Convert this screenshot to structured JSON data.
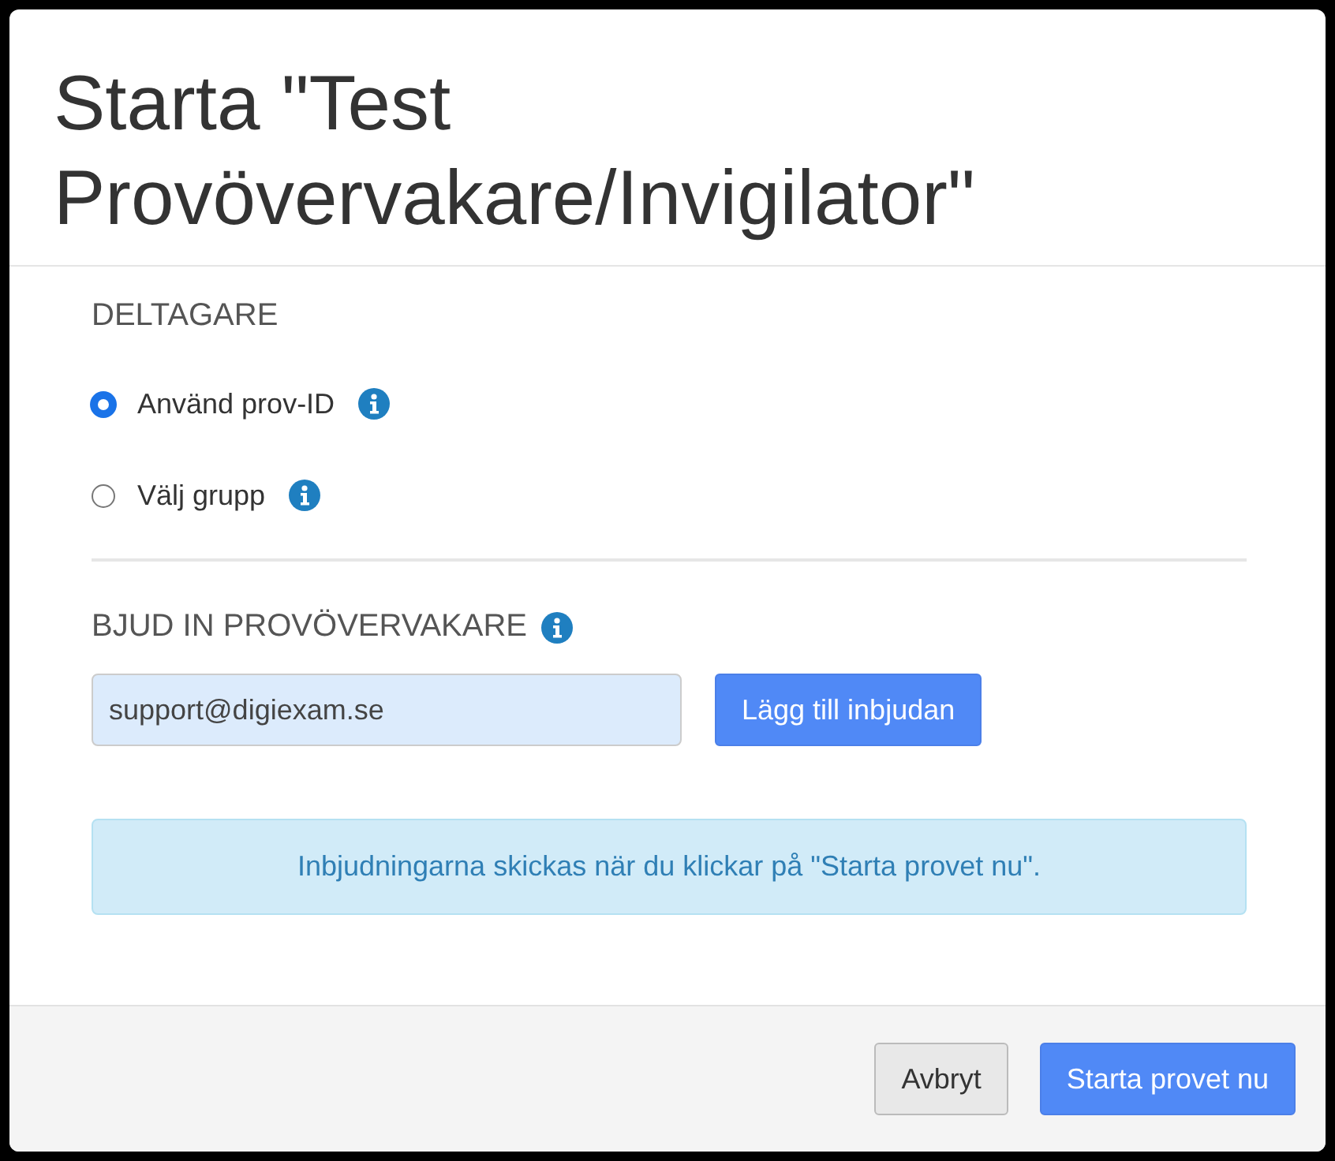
{
  "dialog": {
    "title": "Starta \"Test Provövervakare/Invigilator\""
  },
  "participants": {
    "heading": "DELTAGARE",
    "options": [
      {
        "label": "Använd prov-ID",
        "selected": true,
        "info": true
      },
      {
        "label": "Välj grupp",
        "selected": false,
        "info": true
      }
    ]
  },
  "invite": {
    "heading": "BJUD IN PROVÖVERVAKARE",
    "info": true,
    "email": "support@digiexam.se",
    "add_button": "Lägg till inbjudan"
  },
  "notice": "Inbjudningarna skickas när du klickar på \"Starta provet nu\".",
  "footer": {
    "buttons": [
      {
        "label": "Avbryt",
        "kind": "default"
      },
      {
        "label": "Starta provet nu",
        "kind": "primary"
      }
    ]
  }
}
